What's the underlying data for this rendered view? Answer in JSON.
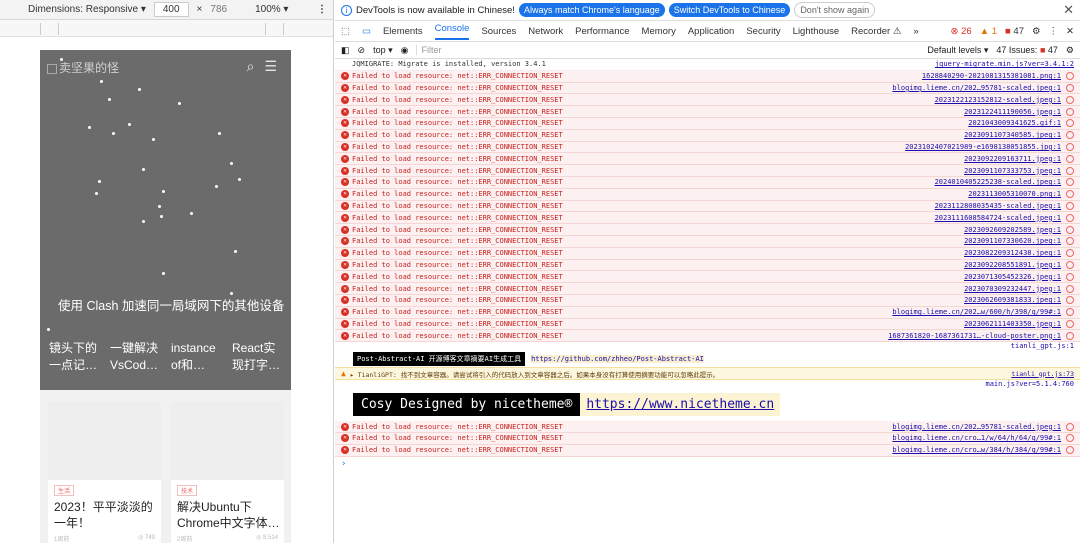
{
  "devbar": {
    "dimensions_label": "Dimensions: Responsive ▾",
    "width": "400",
    "x": "×",
    "height": "786",
    "zoom": "100% ▾",
    "more": "⋮"
  },
  "phone": {
    "logo_alt": "卖坚果的怪",
    "headline": "使用 Clash 加速同一局域网下的其他设备",
    "cards": [
      "镜头下的一点记…",
      "一键解决VsCod…",
      "instance of和…",
      "React实现打字…"
    ],
    "posts": [
      {
        "tag": "生活",
        "title": "2023！平平淡淡的一年！",
        "date": "1周前",
        "views": "◎ 749"
      },
      {
        "tag": "技术",
        "title": "解决Ubuntu下Chrome中文字体…",
        "date": "2周前",
        "views": "◎ 8,514"
      }
    ]
  },
  "infobar": {
    "text": "DevTools is now available in Chinese!",
    "btn1": "Always match Chrome's language",
    "btn2": "Switch DevTools to Chinese",
    "btn3": "Don't show again",
    "close": "✕"
  },
  "tabs": {
    "items": [
      "Elements",
      "Console",
      "Sources",
      "Network",
      "Performance",
      "Memory",
      "Application",
      "Security",
      "Lighthouse",
      "Recorder ⚠",
      "»"
    ],
    "active": 1,
    "errors": "26",
    "warnings": "1",
    "issues_count": "47"
  },
  "toolbar": {
    "context": "top ▾",
    "filter_placeholder": "Filter",
    "levels": "Default levels ▾",
    "issues": "47 Issues:",
    "issues_n": "47"
  },
  "console": {
    "first": {
      "msg": "JQMIGRATE: Migrate is installed, version 3.4.1",
      "src": "jquery-migrate.min.js?ver=3.4.1:2"
    },
    "err_msg": "Failed to load resource: net::ERR_CONNECTION_RESET",
    "errors1": [
      "1628840290-2021081315381081.png:1",
      "blogimg.lieme.cn/202…95781-scaled.jpeg:1",
      "2023122123152812-scaled.jpeg:1",
      "2023122411190056.jpeg:1",
      "2021043009341625.gif:1",
      "2023091107340585.jpeg:1",
      "2023102407021989-e1698138051855.jpg:1",
      "2023092209163711.jpeg:1",
      "2023091107333753.jpeg:1",
      "2024010405225238-scaled.jpeg:1",
      "2023113005310070.png:1",
      "2023112808035435-scaled.jpeg:1",
      "2023111608584724-scaled.jpeg:1",
      "2023092609202589.jpeg:1",
      "2023091107330620.jpeg:1",
      "2023082209312438.jpeg:1",
      "2023092208551891.jpeg:1",
      "2023071305452326.jpeg:1",
      "2023070309232447.jpeg:1",
      "2023062609381833.jpeg:1",
      "blogimg.lieme.cn/202…w/600/h/398/q/99#:1",
      "2023062111403350.jpeg:1",
      "1687361820-1687361731…-cloud-poster.png:1"
    ],
    "tianli": "tianli_gpt.js:1",
    "postabs_label": "Post-Abstract-AI 开源博客文章摘要AI生成工具",
    "postabs_link": "https://github.com/zhheo/Post-Abstract-AI",
    "warn_msg": "▸ TianliGPT: 找不到文章容器。请尝试将引入的代码放入到文章容器之后。如果本身没有打算使用摘要功能可以忽略此提示。",
    "warn_src": "tianli_gpt.js:73",
    "main_src": "main.js?ver=5.1.4:760",
    "cosy_label": "Cosy Designed by nicetheme®",
    "cosy_link": "https://www.nicetheme.cn",
    "errors2": [
      "blogimg.lieme.cn/202…95781-scaled.jpeg:1",
      "blogimg.lieme.cn/cro…1/w/64/h/64/q/99#:1",
      "blogimg.lieme.cn/cro…w/384/h/384/q/99#:1"
    ],
    "prompt": "›"
  }
}
